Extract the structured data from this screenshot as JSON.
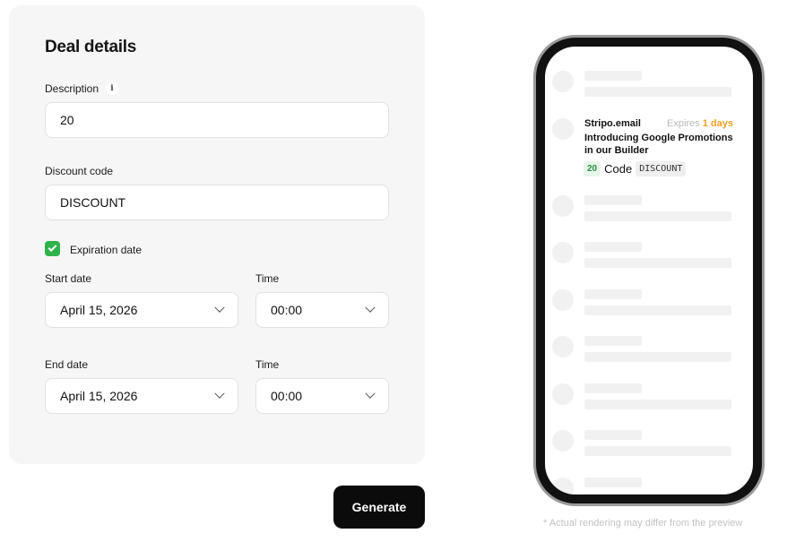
{
  "form": {
    "title": "Deal details",
    "description_label": "Description",
    "description_value": "20",
    "discount_label": "Discount code",
    "discount_value": "DISCOUNT",
    "expiration_label": "Expiration date",
    "expiration_checked": true,
    "start_date_label": "Start date",
    "start_date_value": "April 15, 2026",
    "start_time_label": "Time",
    "start_time_value": "00:00",
    "end_date_label": "End date",
    "end_date_value": "April 15, 2026",
    "end_time_label": "Time",
    "end_time_value": "00:00"
  },
  "generate_label": "Generate",
  "preview": {
    "sender": "Stripo.email",
    "expires_prefix": "Expires",
    "expires_value": "1 days",
    "subject": "Introducing Google Promotions in our Builder",
    "deal_amount": "20",
    "code_label": "Code",
    "code_value": "DISCOUNT"
  },
  "disclaimer": "* Actual rendering may differ from the preview",
  "colors": {
    "accent_green": "#2fb34a",
    "expires_orange": "#f0a021",
    "button_black": "#0b0b0b"
  }
}
